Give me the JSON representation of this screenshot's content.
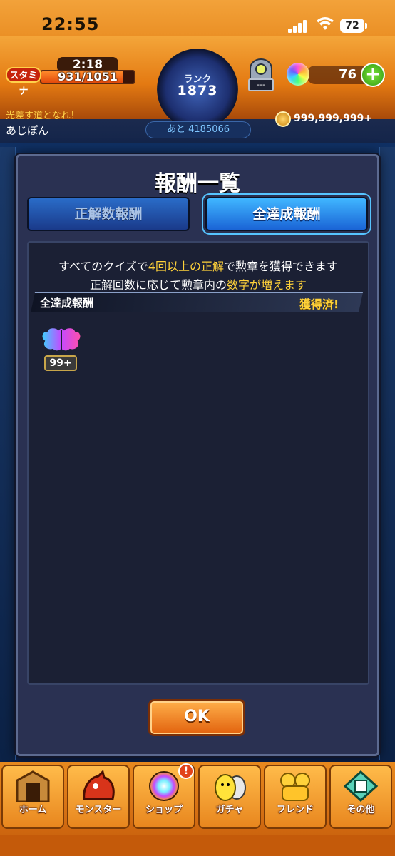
{
  "status_bar": {
    "time": "22:55",
    "battery": "72"
  },
  "header": {
    "stamina_label": "スタミナ",
    "stamina_timer": "2:18",
    "stamina_value": "931/1051",
    "stamina_fill": 0.886,
    "rank_label": "ランク",
    "rank_value": "1873",
    "rank_next": "あと 4185066",
    "orb_counter": "---",
    "orb_count": "76",
    "plus": "+",
    "user_title": "光差す道となれ！",
    "user_name": "あじぽん",
    "coins": "999,999,999+"
  },
  "modal": {
    "title": "報酬一覧",
    "tabs": [
      {
        "label": "正解数報酬",
        "active": false
      },
      {
        "label": "全達成報酬",
        "active": true
      }
    ],
    "desc_line1_a": "すべてのクイズで",
    "desc_line1_hl": "4回以上の正解",
    "desc_line1_b": "で勲章を獲得できます",
    "desc_line2_a": "正解回数に応じて勲章内の",
    "desc_line2_hl": "数字が増えます",
    "reward_label": "全達成報酬",
    "reward_status": "獲得済!",
    "medal_count": "99+",
    "ok_button": "OK"
  },
  "nav": {
    "items": [
      {
        "label": "ホーム",
        "icon": "home-gate-icon"
      },
      {
        "label": "モンスター",
        "icon": "dragon-icon"
      },
      {
        "label": "ショップ",
        "icon": "rainbow-orb-icon"
      },
      {
        "label": "ガチャ",
        "icon": "gacha-egg-icon"
      },
      {
        "label": "フレンド",
        "icon": "friends-icon"
      },
      {
        "label": "その他",
        "icon": "other-menu-icon"
      }
    ],
    "shop_badge": "!"
  },
  "colors": {
    "accent_orange": "#e8891e",
    "highlight_yellow": "#ffd23a",
    "tab_active": "#40b6ff"
  }
}
